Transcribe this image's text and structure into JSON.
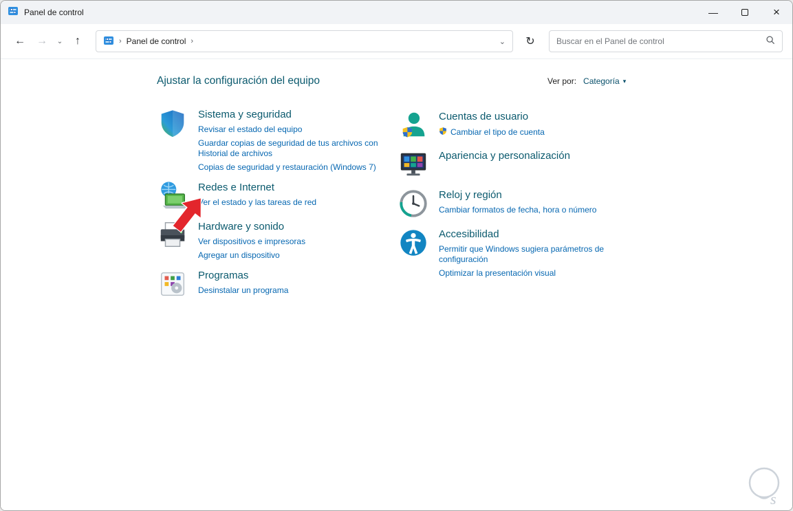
{
  "window": {
    "title": "Panel de control"
  },
  "icons": {
    "back": "←",
    "forward": "→",
    "history_chevron": "⌄",
    "up": "↑",
    "refresh": "↻",
    "crumb_chevron": "›",
    "view_caret": "▾",
    "minimize": "—",
    "close": "×"
  },
  "toolbar": {
    "breadcrumb_root": "Panel de control",
    "search_placeholder": "Buscar en el Panel de control"
  },
  "content": {
    "heading": "Ajustar la configuración del equipo",
    "view_by_label": "Ver por:",
    "view_by_value": "Categoría"
  },
  "categories": {
    "left": [
      {
        "title": "Sistema y seguridad",
        "links": [
          "Revisar el estado del equipo",
          "Guardar copias de seguridad de tus archivos con Historial de archivos",
          "Copias de seguridad y restauración (Windows 7)"
        ]
      },
      {
        "title": "Redes e Internet",
        "links": [
          "Ver el estado y las tareas de red"
        ]
      },
      {
        "title": "Hardware y sonido",
        "links": [
          "Ver dispositivos e impresoras",
          "Agregar un dispositivo"
        ]
      },
      {
        "title": "Programas",
        "links": [
          "Desinstalar un programa"
        ]
      }
    ],
    "right": [
      {
        "title": "Cuentas de usuario",
        "links": [
          "Cambiar el tipo de cuenta"
        ]
      },
      {
        "title": "Apariencia y personalización",
        "links": []
      },
      {
        "title": "Reloj y región",
        "links": [
          "Cambiar formatos de fecha, hora o número"
        ]
      },
      {
        "title": "Accesibilidad",
        "links": [
          "Permitir que Windows sugiera parámetros de configuración",
          "Optimizar la presentación visual"
        ]
      }
    ]
  }
}
